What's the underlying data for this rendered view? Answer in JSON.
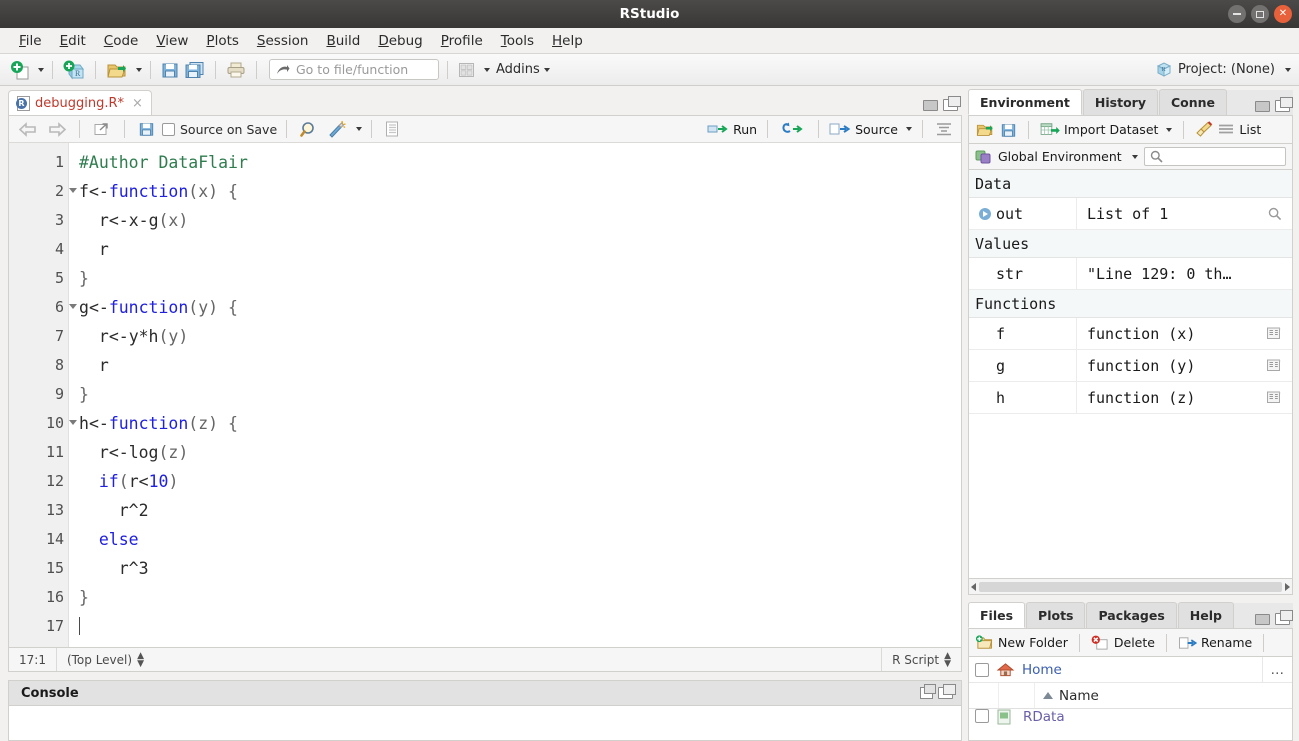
{
  "window": {
    "title": "RStudio",
    "controls": {
      "minimize": "minimize-button",
      "maximize": "maximize-button",
      "close": "close-button"
    }
  },
  "menubar": {
    "items": [
      {
        "label": "File",
        "accel": "F"
      },
      {
        "label": "Edit",
        "accel": "E"
      },
      {
        "label": "Code",
        "accel": "C"
      },
      {
        "label": "View",
        "accel": "V"
      },
      {
        "label": "Plots",
        "accel": "P"
      },
      {
        "label": "Session",
        "accel": "S"
      },
      {
        "label": "Build",
        "accel": "B"
      },
      {
        "label": "Debug",
        "accel": "D"
      },
      {
        "label": "Profile",
        "accel": "P"
      },
      {
        "label": "Tools",
        "accel": "T"
      },
      {
        "label": "Help",
        "accel": "H"
      }
    ]
  },
  "toolbar": {
    "goto_placeholder": "Go to file/function",
    "addins_label": "Addins",
    "project_label": "Project: (None)",
    "icons": [
      "new-file-icon",
      "new-project-icon",
      "open-file-icon",
      "save-icon",
      "save-all-icon",
      "print-icon",
      "goto-arrow-icon",
      "workspace-panes-icon"
    ]
  },
  "source": {
    "tab": {
      "filename": "debugging.R*",
      "close": "×"
    },
    "toolbar": {
      "source_on_save": "Source on Save",
      "run_label": "Run",
      "source_label": "Source",
      "icons": [
        "back-arrow-icon",
        "forward-arrow-icon",
        "show-in-new-window-icon",
        "save-icon",
        "find-icon",
        "code-tools-icon",
        "document-outline-icon",
        "rerun-icon",
        "outline-icon"
      ]
    },
    "lines": [
      {
        "num": "1",
        "fold": false,
        "tokens": [
          {
            "t": "#Author DataFlair",
            "c": "tok-comment"
          }
        ]
      },
      {
        "num": "2",
        "fold": true,
        "tokens": [
          {
            "t": "f",
            "c": "tok-op"
          },
          {
            "t": "<-",
            "c": "tok-op"
          },
          {
            "t": "function",
            "c": "tok-kw"
          },
          {
            "t": "(x) {",
            "c": "tok-pl"
          }
        ]
      },
      {
        "num": "3",
        "fold": false,
        "tokens": [
          {
            "t": "  r",
            "c": "tok-op"
          },
          {
            "t": "<-",
            "c": "tok-op"
          },
          {
            "t": "x",
            "c": "tok-op"
          },
          {
            "t": "-",
            "c": "tok-op"
          },
          {
            "t": "g",
            "c": "tok-op"
          },
          {
            "t": "(x)",
            "c": "tok-pl"
          }
        ]
      },
      {
        "num": "4",
        "fold": false,
        "tokens": [
          {
            "t": "  r",
            "c": "tok-op"
          }
        ]
      },
      {
        "num": "5",
        "fold": false,
        "tokens": [
          {
            "t": "}",
            "c": "tok-pl"
          }
        ]
      },
      {
        "num": "6",
        "fold": true,
        "tokens": [
          {
            "t": "g",
            "c": "tok-op"
          },
          {
            "t": "<-",
            "c": "tok-op"
          },
          {
            "t": "function",
            "c": "tok-kw"
          },
          {
            "t": "(y) {",
            "c": "tok-pl"
          }
        ]
      },
      {
        "num": "7",
        "fold": false,
        "tokens": [
          {
            "t": "  r",
            "c": "tok-op"
          },
          {
            "t": "<-",
            "c": "tok-op"
          },
          {
            "t": "y*h",
            "c": "tok-op"
          },
          {
            "t": "(y)",
            "c": "tok-pl"
          }
        ]
      },
      {
        "num": "8",
        "fold": false,
        "tokens": [
          {
            "t": "  r",
            "c": "tok-op"
          }
        ]
      },
      {
        "num": "9",
        "fold": false,
        "tokens": [
          {
            "t": "}",
            "c": "tok-pl"
          }
        ]
      },
      {
        "num": "10",
        "fold": true,
        "tokens": [
          {
            "t": "h",
            "c": "tok-op"
          },
          {
            "t": "<-",
            "c": "tok-op"
          },
          {
            "t": "function",
            "c": "tok-kw"
          },
          {
            "t": "(z) {",
            "c": "tok-pl"
          }
        ]
      },
      {
        "num": "11",
        "fold": false,
        "tokens": [
          {
            "t": "  r",
            "c": "tok-op"
          },
          {
            "t": "<-",
            "c": "tok-op"
          },
          {
            "t": "log",
            "c": "tok-op"
          },
          {
            "t": "(z)",
            "c": "tok-pl"
          }
        ]
      },
      {
        "num": "12",
        "fold": false,
        "tokens": [
          {
            "t": "  ",
            "c": "tok-op"
          },
          {
            "t": "if",
            "c": "tok-kw"
          },
          {
            "t": "(",
            "c": "tok-pl"
          },
          {
            "t": "r",
            "c": "tok-op"
          },
          {
            "t": "<",
            "c": "tok-op"
          },
          {
            "t": "10",
            "c": "tok-num"
          },
          {
            "t": ")",
            "c": "tok-pl"
          }
        ]
      },
      {
        "num": "13",
        "fold": false,
        "tokens": [
          {
            "t": "    r^2",
            "c": "tok-op"
          }
        ]
      },
      {
        "num": "14",
        "fold": false,
        "tokens": [
          {
            "t": "  ",
            "c": "tok-op"
          },
          {
            "t": "else",
            "c": "tok-kw"
          }
        ]
      },
      {
        "num": "15",
        "fold": false,
        "tokens": [
          {
            "t": "    r^3",
            "c": "tok-op"
          }
        ]
      },
      {
        "num": "16",
        "fold": false,
        "tokens": [
          {
            "t": "}",
            "c": "tok-pl"
          }
        ]
      },
      {
        "num": "17",
        "fold": false,
        "tokens": [],
        "caret": true
      }
    ],
    "status": {
      "position": "17:1",
      "scope": "(Top Level)",
      "filetype": "R Script"
    }
  },
  "console": {
    "title": "Console"
  },
  "environment": {
    "tabs": [
      {
        "label": "Environment",
        "active": true
      },
      {
        "label": "History",
        "active": false
      },
      {
        "label": "Conne",
        "active": false
      }
    ],
    "toolbar": {
      "import_label": "Import Dataset",
      "list_label": "List",
      "icons": [
        "load-workspace-icon",
        "save-workspace-icon",
        "import-dataset-icon",
        "clear-broom-icon",
        "list-view-icon"
      ]
    },
    "selector": {
      "label": "Global Environment",
      "search_placeholder": ""
    },
    "groups": [
      {
        "name": "Data",
        "rows": [
          {
            "name": "out",
            "value": "List of 1",
            "expandable": true,
            "has_view": true
          }
        ]
      },
      {
        "name": "Values",
        "rows": [
          {
            "name": "str",
            "value": "\"Line 129: 0 th…",
            "expandable": false,
            "has_view": false
          }
        ]
      },
      {
        "name": "Functions",
        "rows": [
          {
            "name": "f",
            "value": "function (x)",
            "expandable": false,
            "has_view": true
          },
          {
            "name": "g",
            "value": "function (y)",
            "expandable": false,
            "has_view": true
          },
          {
            "name": "h",
            "value": "function (z)",
            "expandable": false,
            "has_view": true
          }
        ]
      }
    ]
  },
  "files": {
    "tabs": [
      {
        "label": "Files",
        "active": true
      },
      {
        "label": "Plots",
        "active": false
      },
      {
        "label": "Packages",
        "active": false
      },
      {
        "label": "Help",
        "active": false
      }
    ],
    "toolbar": {
      "new_folder": "New Folder",
      "delete": "Delete",
      "rename": "Rename",
      "icons": [
        "new-folder-icon",
        "delete-icon",
        "rename-icon"
      ]
    },
    "breadcrumb": {
      "home": "Home",
      "more": "…"
    },
    "header": {
      "name_column": "Name"
    },
    "rows": [
      {
        "name": "RData"
      }
    ]
  }
}
